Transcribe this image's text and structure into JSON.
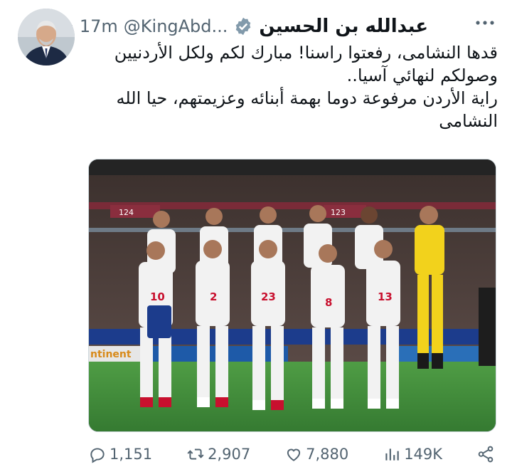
{
  "tweet": {
    "display_name": "عبدالله بن الحسين",
    "handle": "@KingAbd...",
    "time": "· 17m",
    "text": "قدها النشامى، رفعتوا راسنا! مبارك لكم ولكل الأردنيين وصولكم لنهائي آسيا..\nراية الأردن مرفوعة دوما بهمة أبنائه وعزيمتهم، حيا الله النشامى"
  },
  "media": {
    "ad_board_left": "ntinent",
    "stand_sign_left": "124",
    "stand_sign_right": "123",
    "players": [
      {
        "number": "10"
      },
      {
        "number": "2"
      },
      {
        "number": "23"
      },
      {
        "number": "8"
      },
      {
        "number": "13"
      }
    ]
  },
  "actions": {
    "replies": "1,151",
    "reposts": "2,907",
    "likes": "7,880",
    "views": "149K"
  },
  "colors": {
    "text": "#0f1419",
    "secondary": "#536471",
    "verified": "#829aab",
    "pitch": "#3f8f3a",
    "kit": "#f2f2f2",
    "kit_accent": "#c8102e",
    "keeper_kit": "#f2d21c"
  }
}
